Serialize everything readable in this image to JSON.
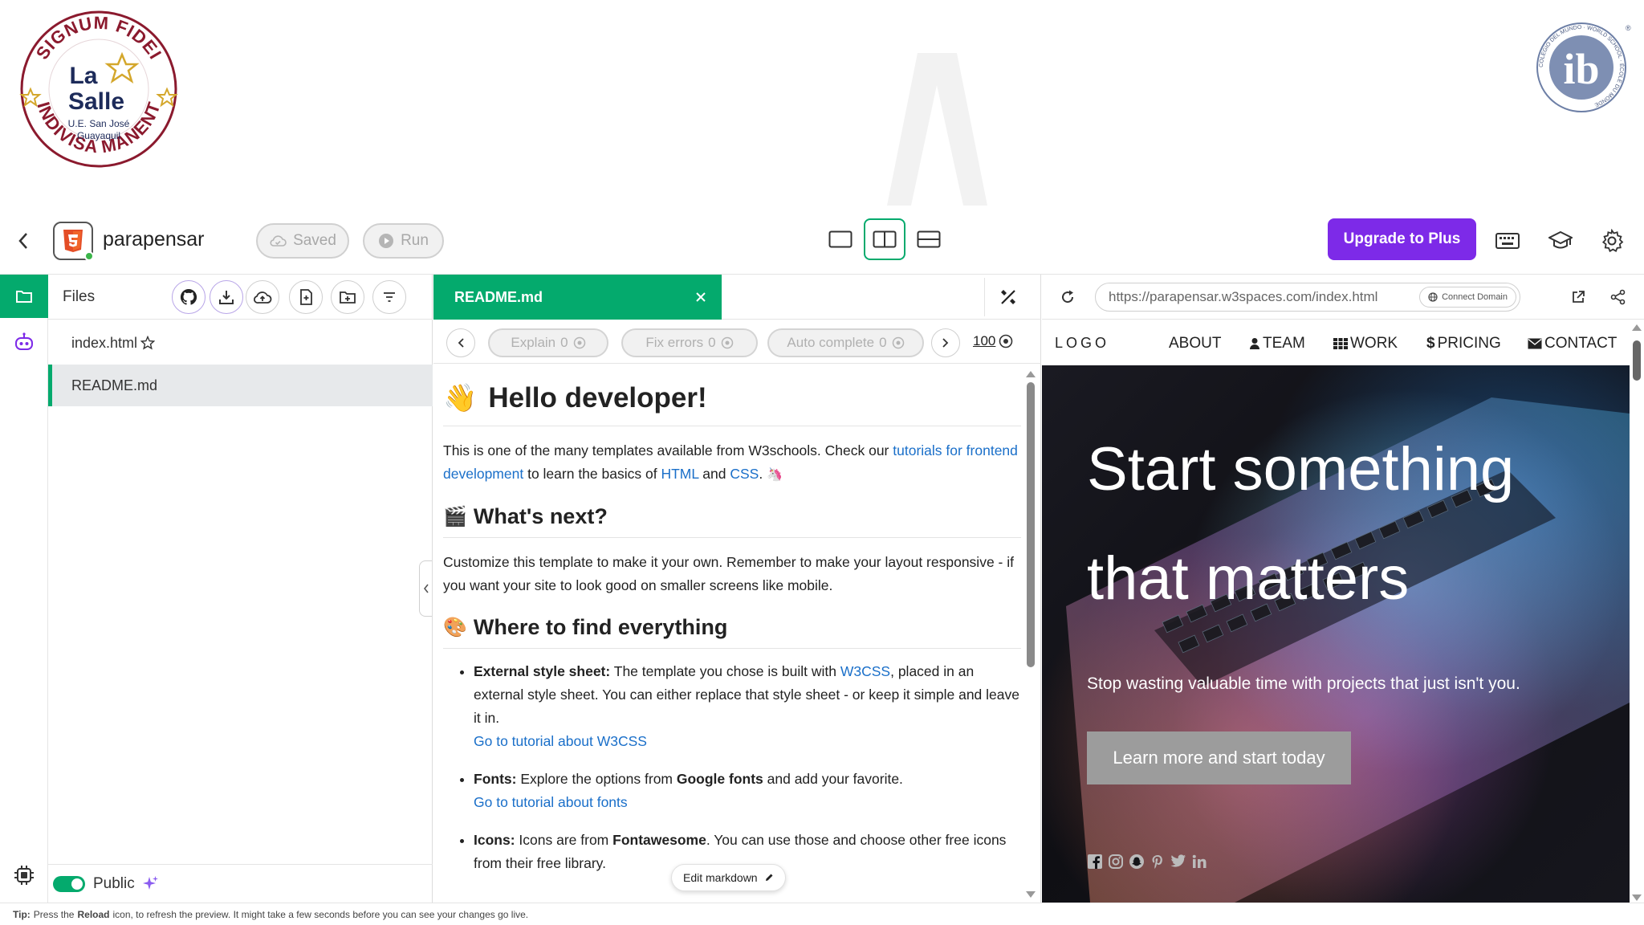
{
  "banner": {
    "left_seal": {
      "top_text": "SIGNUM FIDEI",
      "name_1": "La",
      "name_2": "Salle",
      "line_1": "U.E. San José",
      "line_2": "Guayaquil",
      "bottom_text": "INDIVISA MANENT"
    },
    "right_seal": {
      "letters": "ib",
      "ring_text": "COLEGIO DEL MUNDO · WORLD SCHOOL · ÉCOLE DU MONDE"
    }
  },
  "header": {
    "project_name": "parapensar",
    "saved_label": "Saved",
    "run_label": "Run",
    "upgrade_label": "Upgrade to Plus"
  },
  "files_panel": {
    "title": "Files",
    "files": [
      {
        "name": "index.html",
        "starred": true,
        "active": false
      },
      {
        "name": "README.md",
        "starred": false,
        "active": true
      }
    ],
    "public_label": "Public"
  },
  "editor": {
    "tab_label": "README.md",
    "ai_buttons": [
      {
        "label": "Explain",
        "count": "0"
      },
      {
        "label": "Fix errors",
        "count": "0"
      },
      {
        "label": "Auto complete",
        "count": "0"
      }
    ],
    "credits": "100",
    "edit_markdown_label": "Edit markdown",
    "doc": {
      "h1": "Hello developer!",
      "intro_pre": "This is one of the many templates available from W3schools. Check our ",
      "intro_link1": "tutorials for frontend development",
      "intro_mid": " to learn the basics of ",
      "intro_link2": "HTML",
      "intro_and": " and ",
      "intro_link3": "CSS",
      "intro_end": ".",
      "h2_next": "What's next?",
      "next_text": "Customize this template to make it your own. Remember to make your layout responsive - if you want your site to look good on smaller screens like mobile.",
      "h2_where": "Where to find everything",
      "li1_bold": "External style sheet:",
      "li1_pre": " The template you chose is built with ",
      "li1_link": "W3CSS",
      "li1_post": ", placed in an external style sheet. You can either replace that style sheet - or keep it simple and leave it in.",
      "li1_tut": "Go to tutorial about W3CSS",
      "li2_bold": "Fonts:",
      "li2_pre": " Explore the options from ",
      "li2_mid_bold": "Google fonts",
      "li2_post": " and add your favorite.",
      "li2_tut": "Go to tutorial about fonts",
      "li3_bold": "Icons:",
      "li3_pre": " Icons are from ",
      "li3_mid_bold": "Fontawesome",
      "li3_post": ". You can use those and choose other free icons from their free library."
    }
  },
  "preview": {
    "url": "https://parapensar.w3spaces.com/index.html",
    "connect_label": "Connect Domain",
    "site": {
      "logo": "LOGO",
      "nav": [
        "ABOUT",
        "TEAM",
        "WORK",
        "PRICING",
        "CONTACT"
      ],
      "hero_line1": "Start something",
      "hero_line2": "that matters",
      "hero_sub": "Stop wasting valuable time with projects that just isn't you.",
      "cta": "Learn more and start today",
      "social_icons": [
        "facebook-icon",
        "instagram-icon",
        "snapchat-icon",
        "pinterest-icon",
        "twitter-icon",
        "linkedin-icon"
      ]
    }
  },
  "tip": {
    "prefix": "Tip:",
    "part1": "Press the",
    "bold": "Reload",
    "part2": "icon, to refresh the preview. It might take a few seconds before you can see your changes go live."
  },
  "colors": {
    "accent_green": "#04aa6d",
    "upgrade_purple": "#7d2ae8",
    "link_blue": "#1a6fc9",
    "seal_red": "#8b1a2e",
    "seal_gold": "#d4a72c"
  }
}
